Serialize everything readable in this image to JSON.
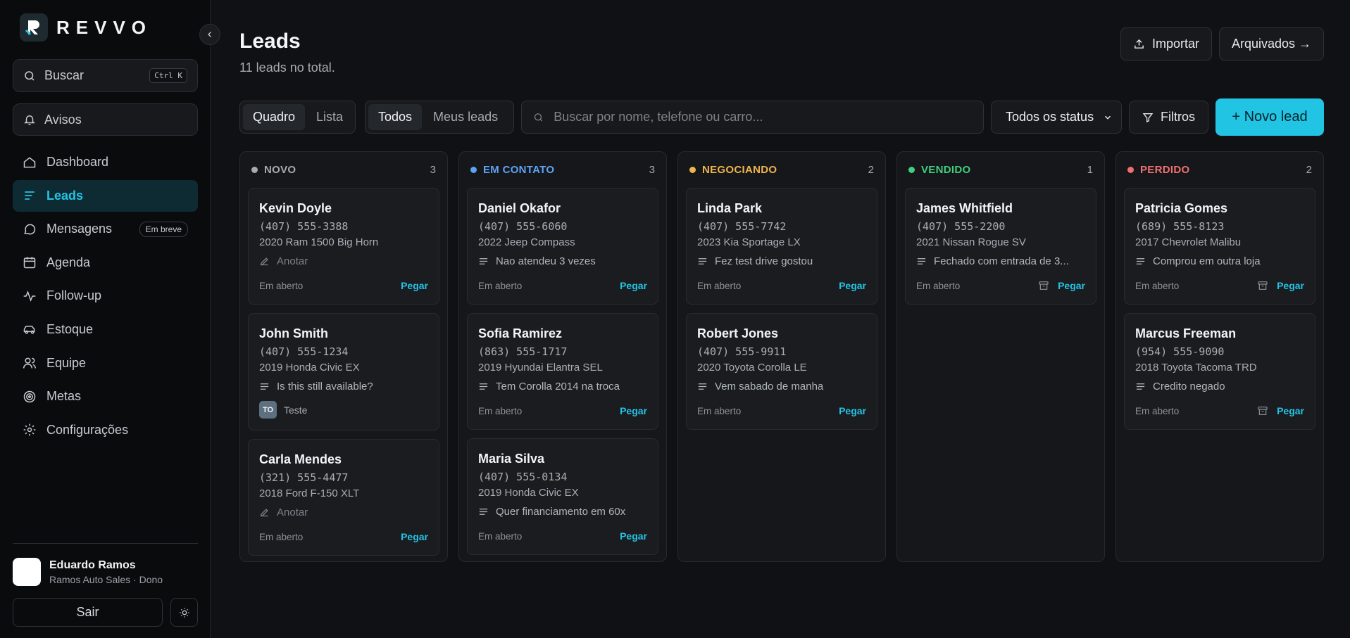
{
  "app": {
    "logo_text": "REVVO"
  },
  "sidebar": {
    "search": {
      "label": "Buscar",
      "shortcut": "Ctrl K"
    },
    "alerts_label": "Avisos",
    "nav": [
      {
        "label": "Dashboard",
        "icon": "home-icon"
      },
      {
        "label": "Leads",
        "icon": "list-icon",
        "active": true
      },
      {
        "label": "Mensagens",
        "icon": "chat-icon",
        "badge": "Em breve"
      },
      {
        "label": "Agenda",
        "icon": "calendar-icon"
      },
      {
        "label": "Follow-up",
        "icon": "activity-icon"
      },
      {
        "label": "Estoque",
        "icon": "car-icon"
      },
      {
        "label": "Equipe",
        "icon": "users-icon"
      },
      {
        "label": "Metas",
        "icon": "target-icon"
      },
      {
        "label": "Configurações",
        "icon": "gear-icon"
      }
    ],
    "user": {
      "name": "Eduardo Ramos",
      "subtitle": "Ramos Auto Sales · Dono"
    },
    "logout_label": "Sair"
  },
  "header": {
    "title": "Leads",
    "subtitle": "11 leads no total.",
    "import_label": "Importar",
    "archived_label": "Arquivados →"
  },
  "toolbar": {
    "view_tabs": [
      "Quadro",
      "Lista"
    ],
    "owner_tabs": [
      "Todos",
      "Meus leads"
    ],
    "search_placeholder": "Buscar por nome, telefone ou carro...",
    "status_selected": "Todos os status",
    "filters_label": "Filtros",
    "new_lead_label": "+ Novo lead"
  },
  "board": {
    "columns": [
      {
        "title": "NOVO",
        "count": "3",
        "color": "#a6abb1",
        "cards": [
          {
            "name": "Kevin Doyle",
            "phone": "(407) 555-3388",
            "car": "2020 Ram 1500 Big Horn",
            "note": "Anotar",
            "placeholder": true,
            "status": "Em aberto",
            "action": "Pegar"
          },
          {
            "name": "John Smith",
            "phone": "(407) 555-1234",
            "car": "2019 Honda Civic EX",
            "note": "Is this still available?",
            "tag": "TO",
            "tag_label": "Teste",
            "status": "",
            "action": ""
          },
          {
            "name": "Carla Mendes",
            "phone": "(321) 555-4477",
            "car": "2018 Ford F-150 XLT",
            "note": "Anotar",
            "placeholder": true,
            "status": "Em aberto",
            "action": "Pegar"
          }
        ]
      },
      {
        "title": "EM CONTATO",
        "count": "3",
        "color": "#5ea3f2",
        "cards": [
          {
            "name": "Daniel Okafor",
            "phone": "(407) 555-6060",
            "car": "2022 Jeep Compass",
            "note": "Nao atendeu 3 vezes",
            "status": "Em aberto",
            "action": "Pegar"
          },
          {
            "name": "Sofia Ramirez",
            "phone": "(863) 555-1717",
            "car": "2019 Hyundai Elantra SEL",
            "note": "Tem Corolla 2014 na troca",
            "status": "Em aberto",
            "action": "Pegar"
          },
          {
            "name": "Maria Silva",
            "phone": "(407) 555-0134",
            "car": "2019 Honda Civic EX",
            "note": "Quer financiamento em 60x",
            "status": "Em aberto",
            "action": "Pegar"
          }
        ]
      },
      {
        "title": "NEGOCIANDO",
        "count": "2",
        "color": "#f0b44c",
        "cards": [
          {
            "name": "Linda Park",
            "phone": "(407) 555-7742",
            "car": "2023 Kia Sportage LX",
            "note": "Fez test drive gostou",
            "status": "Em aberto",
            "action": "Pegar"
          },
          {
            "name": "Robert Jones",
            "phone": "(407) 555-9911",
            "car": "2020 Toyota Corolla LE",
            "note": "Vem sabado de manha",
            "status": "Em aberto",
            "action": "Pegar"
          }
        ]
      },
      {
        "title": "VENDIDO",
        "count": "1",
        "color": "#3fcf7f",
        "cards": [
          {
            "name": "James Whitfield",
            "phone": "(407) 555-2200",
            "car": "2021 Nissan Rogue SV",
            "note": "Fechado com entrada de 3...",
            "status": "Em aberto",
            "action": "Pegar",
            "archive": true
          }
        ]
      },
      {
        "title": "PERDIDO",
        "count": "2",
        "color": "#f07070",
        "cards": [
          {
            "name": "Patricia Gomes",
            "phone": "(689) 555-8123",
            "car": "2017 Chevrolet Malibu",
            "note": "Comprou em outra loja",
            "status": "Em aberto",
            "action": "Pegar",
            "archive": true
          },
          {
            "name": "Marcus Freeman",
            "phone": "(954) 555-9090",
            "car": "2018 Toyota Tacoma TRD",
            "note": "Credito negado",
            "status": "Em aberto",
            "action": "Pegar",
            "archive": true
          }
        ]
      }
    ]
  }
}
